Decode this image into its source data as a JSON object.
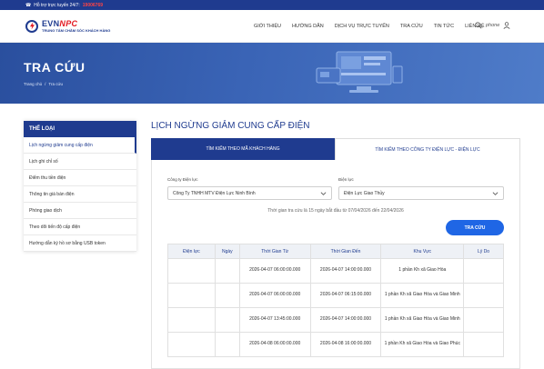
{
  "topbar": {
    "hotline_label": "Hỗ trợ trực tuyến 24/7:",
    "hotline_number": "19006769"
  },
  "logo": {
    "brand_a": "EVN",
    "brand_b": "NPC",
    "subtitle": "TRUNG TÂM CHĂM SÓC KHÁCH HÀNG"
  },
  "nav": {
    "items": [
      "GIỚI THIỆU",
      "HƯỚNG DẪN",
      "DỊCH VỤ TRỰC TUYẾN",
      "TRA CỨU",
      "TIN TỨC",
      "LIÊN HỆ"
    ],
    "phone": "phone"
  },
  "banner": {
    "title": "TRA CỨU",
    "crumb_home": "Trang chủ",
    "crumb_sep": "/",
    "crumb_current": "Tra cứu"
  },
  "sidebar": {
    "heading": "THỂ LOẠI",
    "items": [
      "Lịch ngừng giảm cung cấp điện",
      "Lịch ghi chỉ số",
      "Điểm thu tiền điện",
      "Thông tin giá bán điện",
      "Phòng giao dịch",
      "Theo dõi tiến độ cấp điện",
      "Hướng dẫn ký hồ sơ bằng USB token"
    ]
  },
  "main": {
    "title": "LỊCH NGỪNG GIẢM CUNG CẤP ĐIỆN",
    "tabs": [
      "TÌM KIẾM THEO MÃ KHÁCH HÀNG",
      "TÌM KIẾM THEO CÔNG TY ĐIỆN LỰC - ĐIỆN LỰC"
    ],
    "company_label": "Công ty Điện lực",
    "company_value": "Công Ty TNHH MTV Điện Lực Ninh Bình",
    "unit_label": "Điện lực",
    "unit_value": "Điện Lực Giao Thủy",
    "note": "Thời gian tra cứu là 15 ngày bắt đầu từ 07/04/2026 đến 22/04/2026",
    "search_label": "TRA CỨU"
  },
  "table": {
    "headers": [
      "Điện lực",
      "Ngày",
      "Thời Gian Từ",
      "Thời Gian Đến",
      "Khu Vực",
      "Lý Do"
    ],
    "rows": [
      [
        "",
        "",
        "2026-04-07 06:00:00.000",
        "2026-04-07 14:00:00.000",
        "1 phần Kh xã Giao Hòa",
        ""
      ],
      [
        "",
        "",
        "2026-04-07 06:00:00.000",
        "2026-04-07 06:15:00.000",
        "1 phần Kh xã Giao Hòa và Giao Minh",
        ""
      ],
      [
        "",
        "",
        "2026-04-07 13:45:00.000",
        "2026-04-07 14:00:00.000",
        "1 phần Kh xã Giao Hòa và Giao Minh",
        ""
      ],
      [
        "",
        "",
        "2026-04-08 06:00:00.000",
        "2026-04-08 16:00:00.000",
        "1 phần Kh xã Giao Hòa và Giao Phúc",
        ""
      ]
    ]
  }
}
